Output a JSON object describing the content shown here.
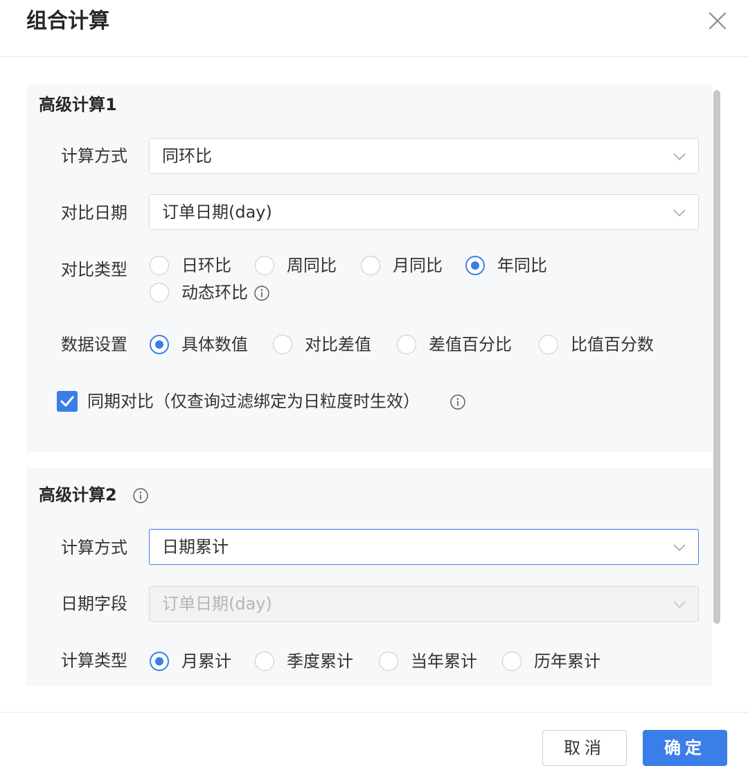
{
  "dialog": {
    "title": "组合计算"
  },
  "section1": {
    "title": "高级计算1",
    "calc_method": {
      "label": "计算方式",
      "value": "同环比"
    },
    "compare_date": {
      "label": "对比日期",
      "value": "订单日期(day)"
    },
    "compare_type": {
      "label": "对比类型",
      "options": [
        "日环比",
        "周同比",
        "月同比",
        "年同比",
        "动态环比"
      ],
      "selected": "年同比"
    },
    "data_setting": {
      "label": "数据设置",
      "options": [
        "具体数值",
        "对比差值",
        "差值百分比",
        "比值百分数"
      ],
      "selected": "具体数值"
    },
    "same_period": {
      "label": "同期对比（仅查询过滤绑定为日粒度时生效）",
      "checked": true
    }
  },
  "section2": {
    "title": "高级计算2",
    "calc_method": {
      "label": "计算方式",
      "value": "日期累计"
    },
    "date_field": {
      "label": "日期字段",
      "value": "订单日期(day)",
      "disabled": true
    },
    "calc_type": {
      "label": "计算类型",
      "options": [
        "月累计",
        "季度累计",
        "当年累计",
        "历年累计"
      ],
      "selected": "月累计"
    }
  },
  "footer": {
    "cancel_label": "取消",
    "ok_label": "确定"
  },
  "colors": {
    "accent": "#3b7ee8",
    "section_bg": "#f7f8f9",
    "border": "#d9d9d9"
  },
  "icons": {
    "close": "close-icon",
    "dropdown": "chevron-down-icon",
    "info": "info-icon",
    "check": "check-icon"
  }
}
